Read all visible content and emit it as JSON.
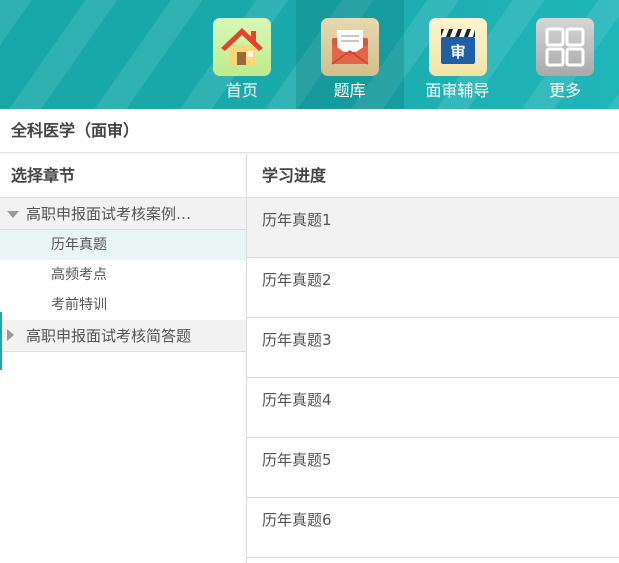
{
  "nav": {
    "items": [
      {
        "label": "首页",
        "icon": "home-icon"
      },
      {
        "label": "题库",
        "icon": "question-bank-icon"
      },
      {
        "label": "面审辅导",
        "icon": "audit-clapper-icon"
      },
      {
        "label": "更多",
        "icon": "grid-more-icon"
      }
    ],
    "audit_icon_glyph": "审",
    "active_index": 1
  },
  "page": {
    "title": "全科医学（面审）"
  },
  "left_panel": {
    "heading": "选择章节",
    "groups": [
      {
        "label": "高职申报面试考核案例…",
        "expanded": true,
        "children": [
          {
            "label": "历年真题",
            "selected": true
          },
          {
            "label": "高频考点",
            "selected": false
          },
          {
            "label": "考前特训",
            "selected": false
          }
        ]
      },
      {
        "label": "高职申报面试考核简答题",
        "expanded": false,
        "children": []
      }
    ]
  },
  "right_panel": {
    "heading": "学习进度",
    "rows": [
      {
        "label": "历年真题1"
      },
      {
        "label": "历年真题2"
      },
      {
        "label": "历年真题3"
      },
      {
        "label": "历年真题4"
      },
      {
        "label": "历年真题5"
      },
      {
        "label": "历年真题6"
      }
    ]
  },
  "colors": {
    "header_teal": "#1aa9ab",
    "accent": "#1ea8a9",
    "selected_bg": "#e9f4f4",
    "group_bg": "#f2f2f2"
  }
}
